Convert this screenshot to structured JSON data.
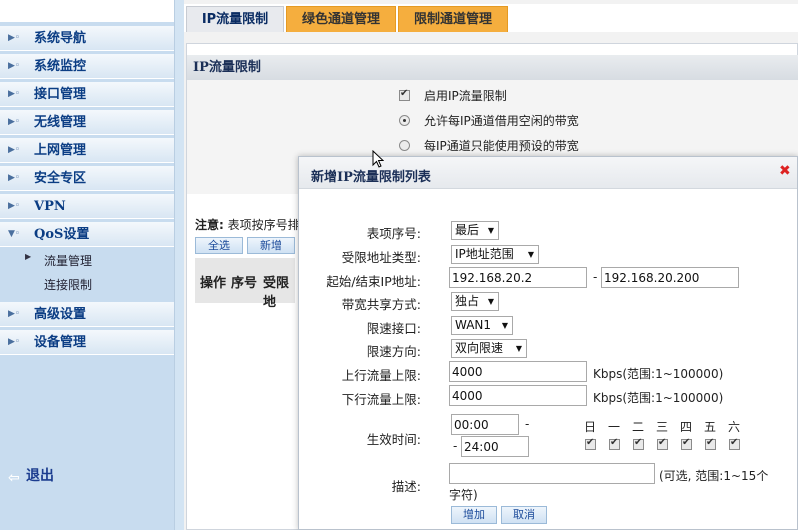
{
  "sidebar": {
    "items": [
      {
        "label": "系统导航"
      },
      {
        "label": "系统监控"
      },
      {
        "label": "接口管理"
      },
      {
        "label": "无线管理"
      },
      {
        "label": "上网管理"
      },
      {
        "label": "安全专区"
      },
      {
        "label": "VPN"
      },
      {
        "label": "QoS设置"
      },
      {
        "label": "高级设置"
      },
      {
        "label": "设备管理"
      }
    ],
    "sub_items": [
      {
        "label": "流量管理"
      },
      {
        "label": "连接限制"
      }
    ],
    "logout": "退出"
  },
  "tabs": [
    {
      "label": "IP流量限制"
    },
    {
      "label": "绿色通道管理"
    },
    {
      "label": "限制通道管理"
    }
  ],
  "panel": {
    "title": "IP流量限制",
    "options": {
      "enable": "启用IP流量限制",
      "allow_borrow": "允许每IP通道借用空闲的带宽",
      "preset_only": "每IP通道只能使用预设的带宽"
    },
    "note_label": "注意:",
    "note_text": "表项按序号排",
    "buttons": {
      "select_all": "全选",
      "add": "新增"
    },
    "columns": [
      "操作",
      "序号",
      "受限地"
    ]
  },
  "dialog": {
    "title": "新增IP流量限制列表",
    "fields": {
      "index_label": "表项序号:",
      "index_value": "最后",
      "addr_type_label": "受限地址类型:",
      "addr_type_value": "IP地址范围",
      "ip_range_label": "起始/结束IP地址:",
      "start_ip": "192.168.20.2",
      "end_ip": "192.168.20.200",
      "share_label": "带宽共享方式:",
      "share_value": "独占",
      "iface_label": "限速接口:",
      "iface_value": "WAN1",
      "dir_label": "限速方向:",
      "dir_value": "双向限速",
      "up_label": "上行流量上限:",
      "up_value": "4000",
      "up_unit": "Kbps(范围:1~100000)",
      "down_label": "下行流量上限:",
      "down_value": "4000",
      "down_unit": "Kbps(范围:1~100000)",
      "time_label": "生效时间:",
      "time_start": "00:00",
      "time_end": "24:00",
      "dash": "-",
      "days": [
        "日",
        "一",
        "二",
        "三",
        "四",
        "五",
        "六"
      ],
      "desc_label": "描述:",
      "desc_hint_1": "(可选, 范围:1~15个",
      "desc_hint_2": "字符)"
    },
    "buttons": {
      "add": "增加",
      "cancel": "取消"
    }
  }
}
